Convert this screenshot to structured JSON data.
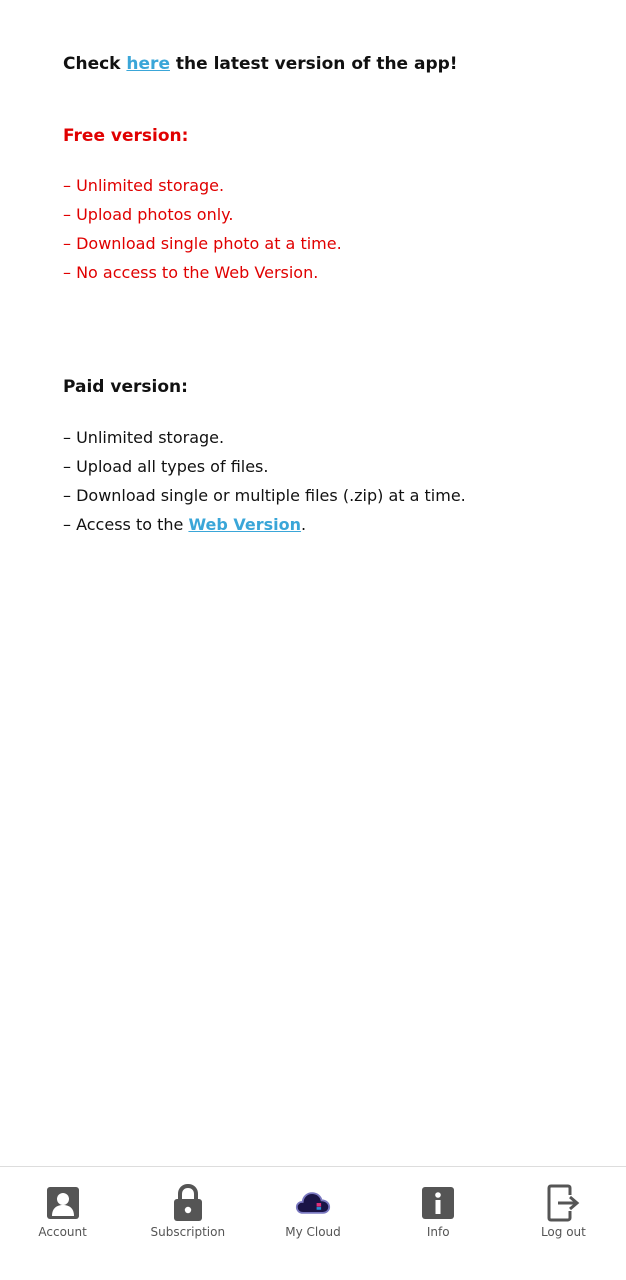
{
  "intro": {
    "before_link": "Check ",
    "link_text": "here",
    "after_link": " the latest version of the app!"
  },
  "free": {
    "title": "Free version:",
    "items": [
      "– Unlimited storage.",
      "– Upload photos only.",
      "– Download single photo at a time.",
      "– No access to the Web Version."
    ]
  },
  "paid": {
    "title": "Paid version:",
    "items": [
      "– Unlimited storage.",
      "– Upload all types of files.",
      "– Download single or multiple files (.zip) at a time."
    ],
    "last_item_before": "– Access to the ",
    "last_item_link": "Web Version",
    "last_item_after": "."
  },
  "nav": {
    "items": [
      {
        "label": "Account",
        "icon": "account-icon"
      },
      {
        "label": "Subscription",
        "icon": "lock-icon"
      },
      {
        "label": "My Cloud",
        "icon": "cloud-icon"
      },
      {
        "label": "Info",
        "icon": "info-icon"
      },
      {
        "label": "Log out",
        "icon": "logout-icon"
      }
    ]
  },
  "colors": {
    "free_text": "#e00000",
    "link": "#3aa6d8",
    "icon": "#555555"
  }
}
